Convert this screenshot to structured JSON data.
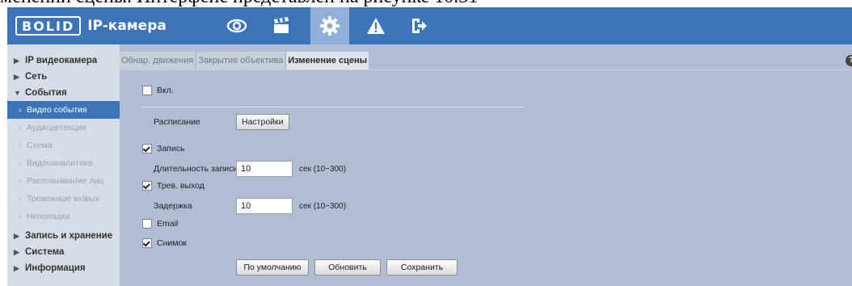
{
  "caption": "менении сцены. Интерфейс представлен на рисунке 10.31",
  "header": {
    "logo": "BOLID",
    "title": "IP-камера",
    "nav": [
      "eye-icon",
      "clapperboard-icon",
      "gear-icon",
      "warning-icon",
      "logout-icon"
    ],
    "active_nav": "gear-icon",
    "accent": "#3c74b8"
  },
  "sidebar": {
    "sections": [
      {
        "label": "IP видеокамера"
      },
      {
        "label": "Сеть"
      },
      {
        "label": "События"
      }
    ],
    "sub_items": [
      {
        "label": "Видео события",
        "active": true
      },
      {
        "label": "Аудиодетекция"
      },
      {
        "label": "Схема"
      },
      {
        "label": "Видеоаналитика"
      },
      {
        "label": "Распознавание лиц"
      },
      {
        "label": "Тревожные вх/вых"
      },
      {
        "label": "Неполадки"
      }
    ],
    "sections_after": [
      {
        "label": "Запись и хранение"
      },
      {
        "label": "Система"
      },
      {
        "label": "Информация"
      }
    ]
  },
  "tabs": [
    "Обнар. движения",
    "Закрытие объектива",
    "Изменение сцены"
  ],
  "active_tab": "Изменение сцены",
  "help": "?",
  "form": {
    "enable_label": "Вкл.",
    "enable_checked": false,
    "schedule_label": "Расписание",
    "settings_button": "Настройки",
    "record_label": "Запись",
    "record_checked": true,
    "record_duration_label": "Длительность записи",
    "record_duration_value": "10",
    "record_duration_unit": "сек (10~300)",
    "alarm_out_label": "Трев. выход",
    "alarm_out_checked": true,
    "delay_label": "Задержка",
    "delay_value": "10",
    "delay_unit": "сек (10~300)",
    "email_label": "Email",
    "email_checked": false,
    "snapshot_label": "Снимок",
    "snapshot_checked": true
  },
  "buttons": {
    "default": "По умолчанию",
    "refresh": "Обновить",
    "save": "Сохранить"
  }
}
